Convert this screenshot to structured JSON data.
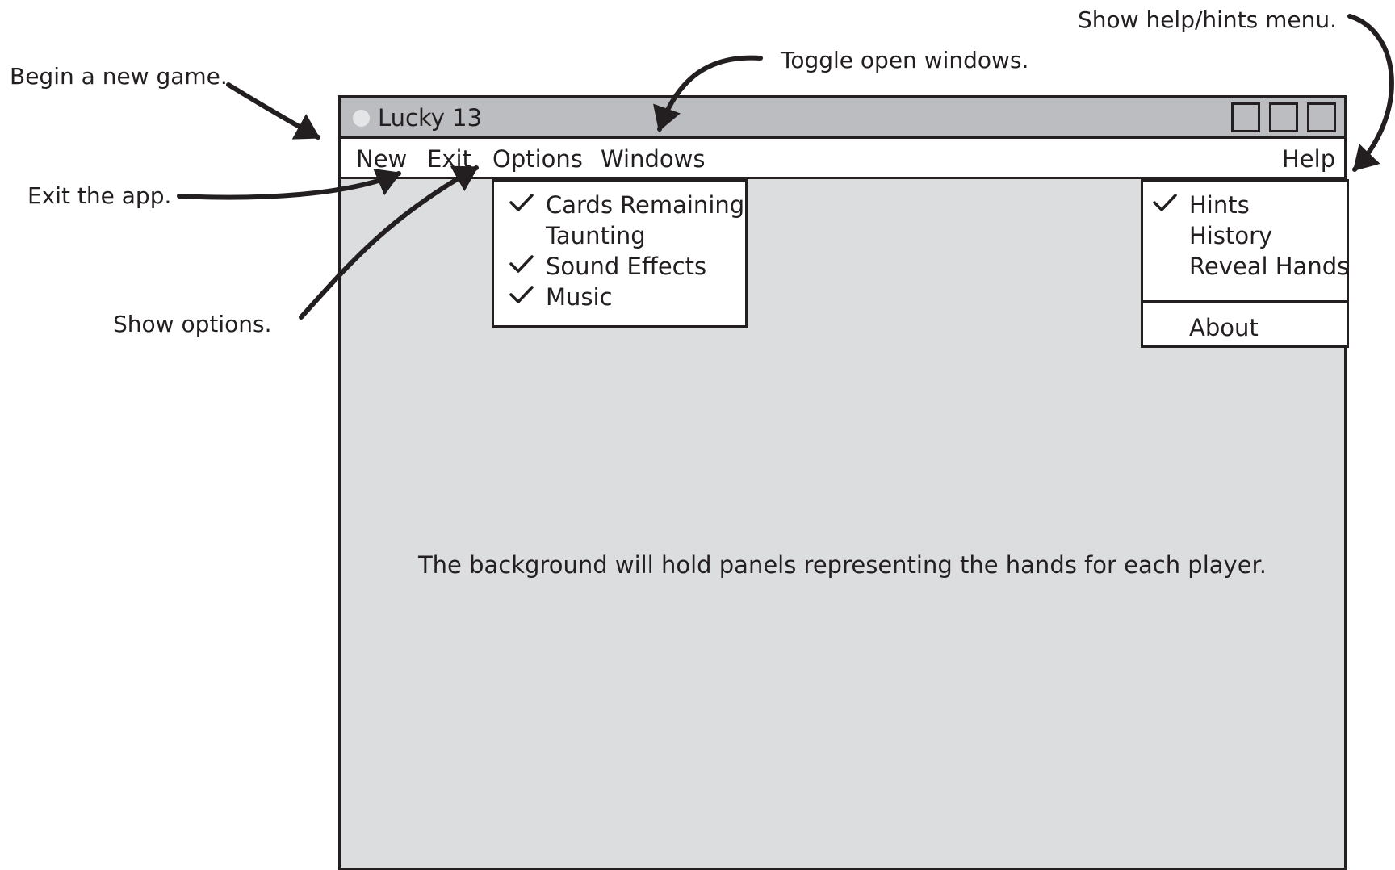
{
  "annotations": {
    "new_game": "Begin a new game.",
    "exit_app": "Exit the app.",
    "show_options": "Show options.",
    "toggle_windows": "Toggle open windows.",
    "show_help": "Show help/hints menu."
  },
  "window": {
    "title": "Lucky 13",
    "menu": {
      "new": "New",
      "exit": "Exit",
      "options": "Options",
      "windows": "Windows",
      "help": "Help"
    },
    "options_menu": {
      "items": [
        {
          "label": "Cards Remaining",
          "checked": true
        },
        {
          "label": "Taunting",
          "checked": false
        },
        {
          "label": "Sound Effects",
          "checked": true
        },
        {
          "label": "Music",
          "checked": true
        }
      ]
    },
    "help_menu": {
      "items": [
        {
          "label": "Hints",
          "checked": true
        },
        {
          "label": "History",
          "checked": false
        },
        {
          "label": "Reveal Hands",
          "checked": false
        }
      ],
      "about": "About"
    },
    "background_text": "The background will hold panels representing the hands for each player."
  },
  "colors": {
    "ink": "#231f20",
    "window_background": "#dcdddf",
    "titlebar": "#bcbdc0",
    "menu_background": "#ffffff"
  }
}
